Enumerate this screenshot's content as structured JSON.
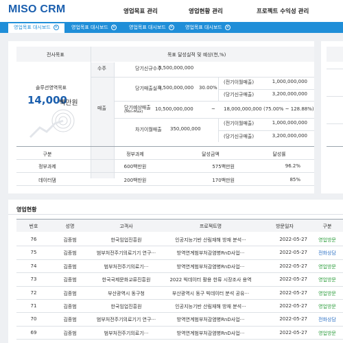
{
  "app": {
    "logo": "MISO CRM"
  },
  "nav": [
    "영업목표 관리",
    "영업현황 관리",
    "프로젝트 수익성 관리"
  ],
  "tabs": [
    "영업목표 대시보드",
    "영업목표 대시보드",
    "영업목표 대시보드",
    "영업목표 대시보드"
  ],
  "goal": {
    "left_header": "전사목표",
    "right_header": "목표 달성실적 및 예상(천,%)",
    "target_label": "솔루션영역목표",
    "target_value": "14,000",
    "target_unit": "백만원",
    "order_label": "수주",
    "order_row": {
      "label": "당기신규수주",
      "value": "3,500,000,000"
    },
    "sales_label": "매출",
    "sales_rows": [
      {
        "label": "당기매출실적",
        "value": "3,500,000,000",
        "pct": "30.00%",
        "sub": [
          {
            "label": "(전기이월매출)",
            "value": "1,000,000,000"
          },
          {
            "label": "(당기신규매출)",
            "value": "3,200,000,000"
          }
        ]
      },
      {
        "label": "당기예상매출",
        "label2": "(Min-Max)",
        "value": "10,500,000,000",
        "dash": "~",
        "value2": "18,000,000,000",
        "range": "(75.00% ~ 128.88%)"
      },
      {
        "label": "차기이월매출",
        "value": "350,000,000",
        "sub": [
          {
            "label": "(전기이월매출)",
            "value": "1,000,000,000"
          },
          {
            "label": "(당기신규매출)",
            "value": "3,200,000,000"
          }
        ]
      }
    ]
  },
  "summary": {
    "headers": [
      "구분",
      "정부과제",
      "달성금액",
      "달성률"
    ],
    "rows": [
      [
        "정부과제",
        "600백만원",
        "575백만원",
        "96.2%"
      ],
      [
        "데이터댐",
        "200백만원",
        "170백만원",
        "85%"
      ]
    ]
  },
  "status": {
    "title": "영업현황",
    "headers": [
      "번호",
      "성명",
      "고객사",
      "프로젝트명",
      "방문일자",
      "구분"
    ],
    "rows": [
      [
        "76",
        "김종범",
        "한국임업진흥원",
        "인공지능기반 산림재해 방재 분석···",
        "2022-05-27",
        "영업방문"
      ],
      [
        "75",
        "김종범",
        "범부처전주기의료기기 연구···",
        "방역연계범부처감염병RnD사업···",
        "2022-05-27",
        "전화상담"
      ],
      [
        "74",
        "김종범",
        "범부처전주기의료기···",
        "방역연계범부처감염병RnD사업···",
        "2022-05-27",
        "영업방문"
      ],
      [
        "73",
        "김종범",
        "한국국제문화교류진흥원",
        "2022 빅데이터 활용 한류 시장조사 용역",
        "2022-05-27",
        "영업방문"
      ],
      [
        "72",
        "김종범",
        "부산광역시 동구청",
        "부산광역시 동구 빅데이터 분석 공유···",
        "2022-05-27",
        "영업방문"
      ],
      [
        "71",
        "김종범",
        "한국임업진흥원",
        "인공지능기반 산림재해 방재 분석···",
        "2022-05-27",
        "영업방문"
      ],
      [
        "70",
        "김종범",
        "범부처전주기의료기기 연구···",
        "방역연계범부처감염병RnD사업···",
        "2022-05-27",
        "전화상담"
      ],
      [
        "69",
        "김종범",
        "범부처전주기의료기···",
        "방역연계범부처감염병RnD사업···",
        "2022-05-27",
        "영업방문"
      ]
    ]
  },
  "colors": {
    "brand": "#1b5fae",
    "tabbar": "#1f8ed8",
    "accent_green": "#2e9e3e",
    "accent_blue": "#2a6fc4"
  }
}
